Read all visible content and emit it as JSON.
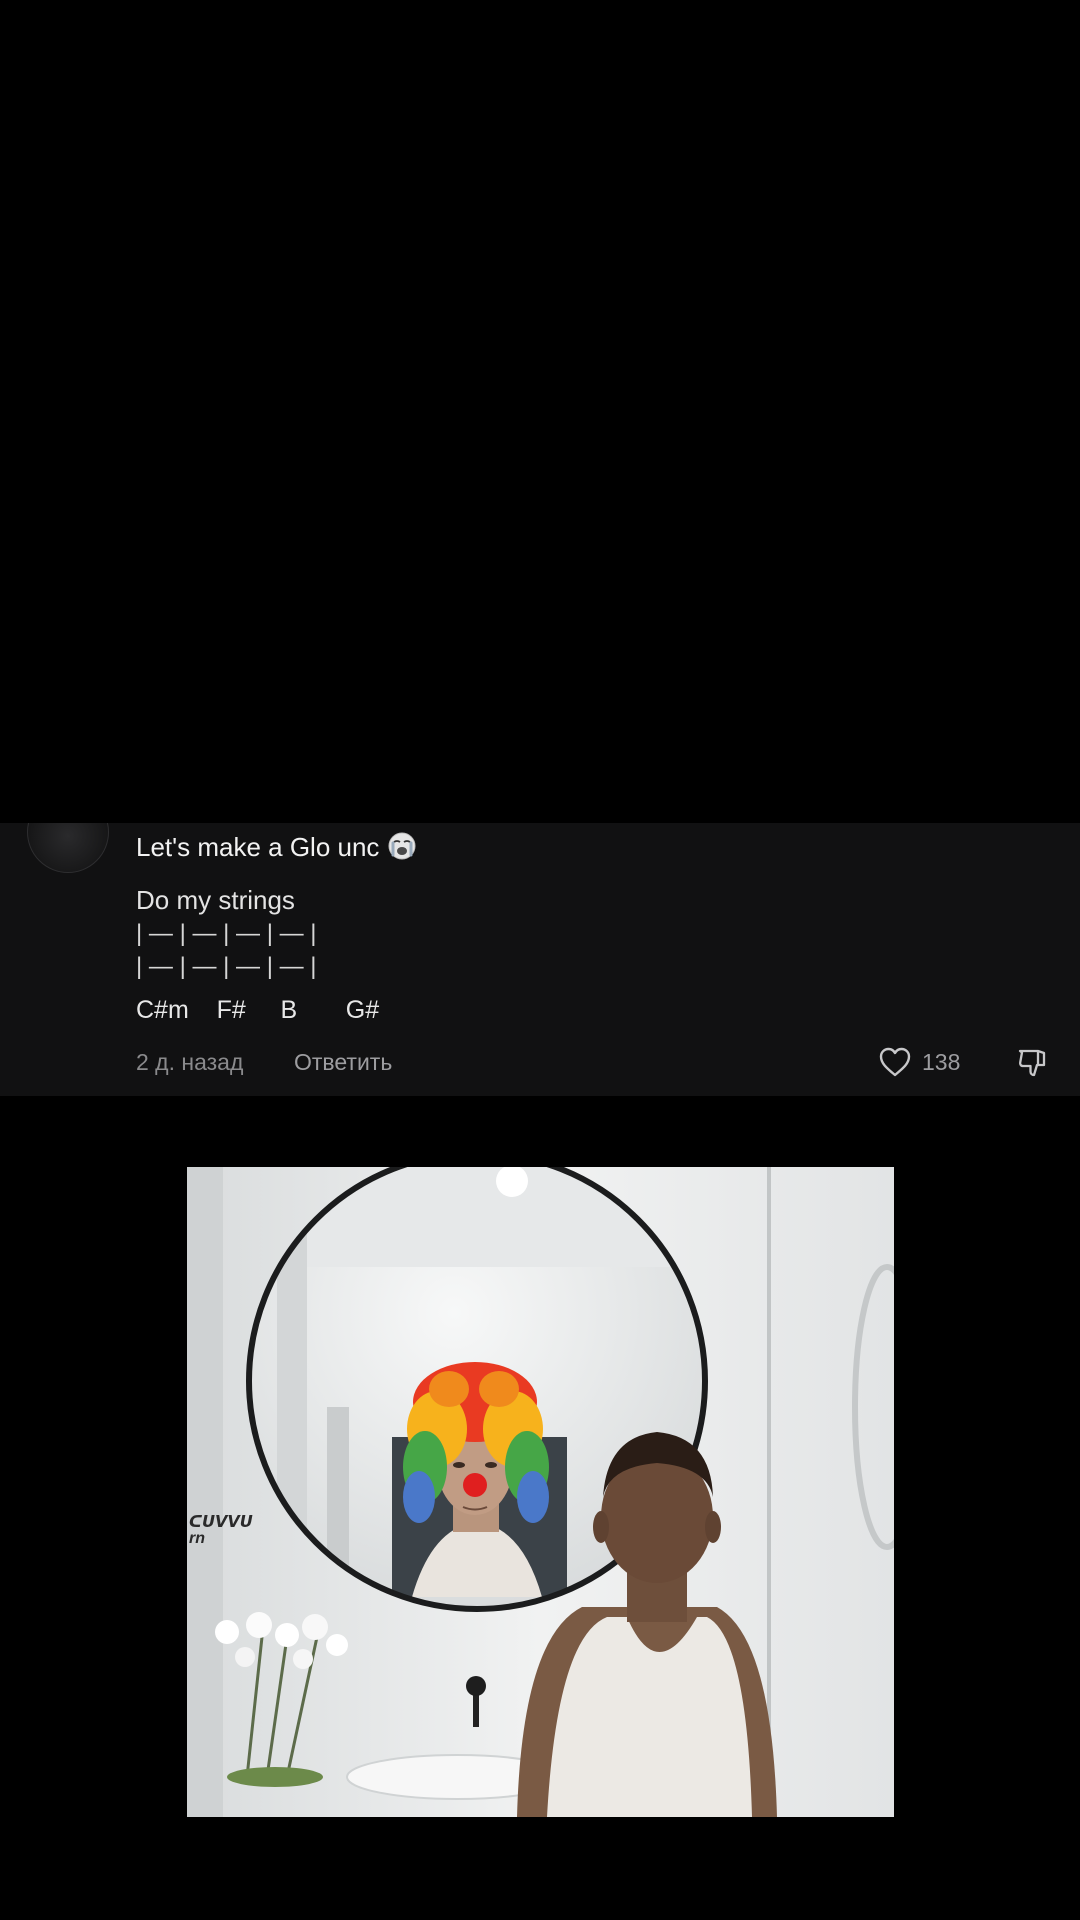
{
  "comment": {
    "text": "Let's make a Glo unc",
    "emoji": "loudly-crying-face-emoji",
    "body": "Do my strings",
    "tab_line_1": "| — | — | — | — |",
    "tab_line_2": "| — | — | — | — |",
    "chords": "C#m    F#     B       G#",
    "timestamp": "2 д. назад",
    "reply_label": "Ответить",
    "like_count": "138"
  },
  "image": {
    "subject": "man-looking-in-mirror-seeing-clown-reflection",
    "wall_text_1": "ᑕᑌᐯᐯᑌ",
    "wall_text_2": "rn"
  },
  "colors": {
    "background": "#000000",
    "card_background": "#111112",
    "primary_text": "#f2f2f2",
    "secondary_text": "#8a8a8c"
  }
}
